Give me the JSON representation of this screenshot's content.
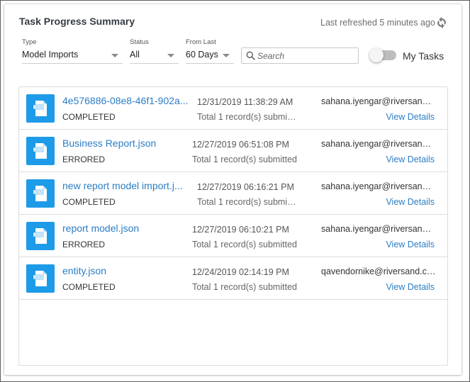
{
  "header": {
    "title": "Task Progress Summary",
    "refreshed": "Last refreshed 5 minutes ago"
  },
  "filters": {
    "type": {
      "label": "Type",
      "value": "Model Imports"
    },
    "status": {
      "label": "Status",
      "value": "All"
    },
    "from_last": {
      "label": "From Last",
      "value": "60 Days"
    },
    "search_placeholder": "Search",
    "my_tasks_label": "My Tasks",
    "my_tasks_on": false
  },
  "icon_label": "JSON",
  "view_details_label": "View Details",
  "tasks": [
    {
      "name": "4e576886-08e8-46f1-902a...",
      "status": "COMPLETED",
      "date": "12/31/2019 11:38:29 AM",
      "records": "Total 1 record(s) submitted",
      "email": "sahana.iyengar@riversand.c..."
    },
    {
      "name": "Business Report.json",
      "status": "ERRORED",
      "date": "12/27/2019 06:51:08 PM",
      "records": "Total 1 record(s) submitted",
      "email": "sahana.iyengar@riversand.c..."
    },
    {
      "name": "new report model import.j...",
      "status": "COMPLETED",
      "date": "12/27/2019 06:16:21 PM",
      "records": "Total 1 record(s) submitt...",
      "email": "sahana.iyengar@riversand.c..."
    },
    {
      "name": "report model.json",
      "status": "ERRORED",
      "date": "12/27/2019 06:10:21 PM",
      "records": "Total 1 record(s) submitted",
      "email": "sahana.iyengar@riversand.c..."
    },
    {
      "name": "entity.json",
      "status": "COMPLETED",
      "date": "12/24/2019 02:14:19 PM",
      "records": "Total 1 record(s) submitted",
      "email": "qavendornike@riversand.com"
    }
  ]
}
